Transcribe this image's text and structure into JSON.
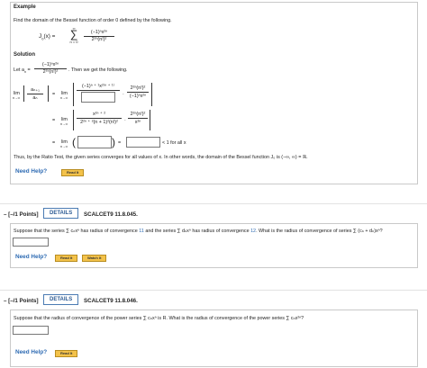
{
  "example": {
    "heading": "Example",
    "prompt": "Find the domain of the Bessel function of order 0 defined by the following.",
    "formula_lhs": "J",
    "formula_lhs_sub": "0",
    "formula_arg": "(x) =",
    "sigma": "∑",
    "sum_top": "∞",
    "sum_bottom": "n = 0",
    "numerator": "(−1)ⁿx²ⁿ",
    "denominator": "2²ⁿ(n!)²",
    "solution_heading": "Solution",
    "let_prefix": "Let a",
    "let_sub": "n",
    "let_eq": "=",
    "let_num": "(−1)ⁿx²ⁿ",
    "let_den": "2²ⁿ(n!)²",
    "let_suffix": ". Then we get the following.",
    "lim": "lim",
    "lim_under": "n→∞",
    "ratio_num": "aₙ₊₁",
    "ratio_den": "aₙ",
    "eq": "=",
    "step1_num": "(−1)ⁿ ⁺ ¹x²⁽ⁿ ⁺ ¹⁾",
    "step1_right_num": "2²ⁿ(n!)²",
    "step1_right_den": "(−1)ⁿx²ⁿ",
    "dot": "·",
    "step2_num": "x²ⁿ ⁺ ²",
    "step2_den": "2²ⁿ ⁺ ²(n + 1)²(n!)²",
    "step2_right_num": "2²ⁿ(n!)²",
    "step2_right_den": "x²ⁿ",
    "step3_tail": "< 1 for all x",
    "conclusion": "Thus, by the Ratio Test, the given series converges for all values of x. In other words, the domain of the Bessel function J₀ is (−∞, ∞) = ℝ.",
    "need_help": "Need Help?",
    "read_it": "Read It"
  },
  "questions": [
    {
      "points": "– [–/1 Points]",
      "details": "DETAILS",
      "code": "SCALCET9 11.8.045.",
      "text_a": "Suppose that the series ∑ cₙxⁿ has radius of convergence ",
      "num_a": "11",
      "text_b": " and the series ∑ dₙxⁿ has radius of convergence ",
      "num_b": "12",
      "text_c": ". What is the radius of convergence of series ∑ (cₙ + dₙ)xⁿ?",
      "need_help": "Need Help?",
      "read_it": "Read It",
      "watch_it": "Watch It"
    },
    {
      "points": "– [–/1 Points]",
      "details": "DETAILS",
      "code": "SCALCET9 11.8.046.",
      "text_a": "Suppose that the radius of convergence of the power series ∑ cₙxⁿ is R. What is the radius of convergence of the power series ∑ cₙx²ⁿ?",
      "need_help": "Need Help?",
      "read_it": "Read It"
    }
  ],
  "colors": {
    "need_help": "#2e6bb3",
    "highlight": "#2e6bb3",
    "button": "#f3c24a"
  }
}
